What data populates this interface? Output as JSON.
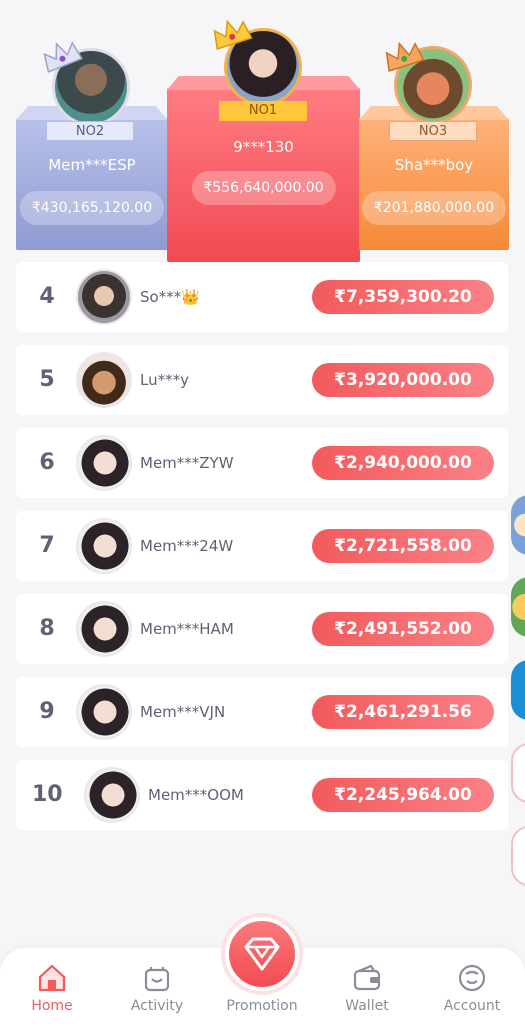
{
  "podium": {
    "first": {
      "badge": "NO1",
      "name": "9***130",
      "amount": "₹556,640,000.00"
    },
    "second": {
      "badge": "NO2",
      "name": "Mem***ESP",
      "amount": "₹430,165,120.00"
    },
    "third": {
      "badge": "NO3",
      "name": "Sha***boy",
      "amount": "₹201,880,000.00"
    }
  },
  "ranking": [
    {
      "rank": "4",
      "name": "So***👑",
      "amount": "₹7,359,300.20"
    },
    {
      "rank": "5",
      "name": "Lu***y",
      "amount": "₹3,920,000.00"
    },
    {
      "rank": "6",
      "name": "Mem***ZYW",
      "amount": "₹2,940,000.00"
    },
    {
      "rank": "7",
      "name": "Mem***24W",
      "amount": "₹2,721,558.00"
    },
    {
      "rank": "8",
      "name": "Mem***HAM",
      "amount": "₹2,491,552.00"
    },
    {
      "rank": "9",
      "name": "Mem***VJN",
      "amount": "₹2,461,291.56"
    },
    {
      "rank": "10",
      "name": "Mem***OOM",
      "amount": "₹2,245,964.00"
    }
  ],
  "nav": {
    "home": "Home",
    "activity": "Activity",
    "promotion": "Promotion",
    "wallet": "Wallet",
    "account": "Account"
  },
  "colors": {
    "accent": "#f25a5d",
    "gold": "#ffc53d",
    "silver": "#8f9ad0",
    "bronze": "#f58a37"
  }
}
